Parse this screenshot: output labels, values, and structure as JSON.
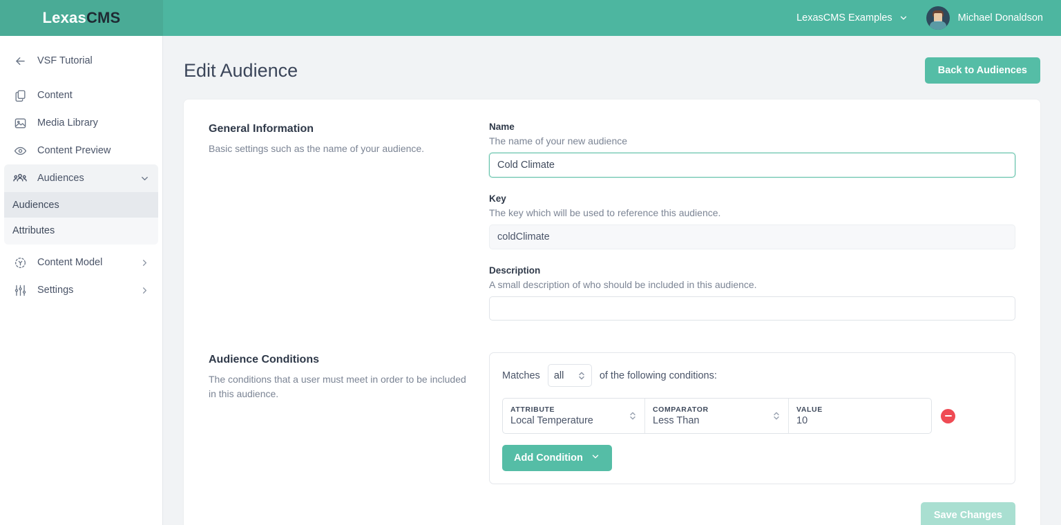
{
  "brand": {
    "logo_primary": "Lexas",
    "logo_secondary": "CMS",
    "accent": "#55bda6",
    "topbar_bg": "#4db6a0",
    "danger": "#ef4b54"
  },
  "topbar": {
    "org_switcher_label": "LexasCMS Examples",
    "org_switcher_icon": "chevron-down-icon",
    "avatar_icon": "user-avatar",
    "user_name": "Michael Donaldson"
  },
  "sidebar": {
    "back": {
      "label": "VSF Tutorial",
      "icon": "arrow-left-icon"
    },
    "items": [
      {
        "label": "Content",
        "icon": "documents-icon",
        "caret": ""
      },
      {
        "label": "Media Library",
        "icon": "image-icon",
        "caret": ""
      },
      {
        "label": "Content Preview",
        "icon": "eye-icon",
        "caret": ""
      },
      {
        "label": "Audiences",
        "icon": "users-icon",
        "caret": "chevron-down-icon"
      },
      {
        "label": "Content Model",
        "icon": "content-model-icon",
        "caret": "chevron-right-icon"
      },
      {
        "label": "Settings",
        "icon": "sliders-icon",
        "caret": "chevron-right-icon"
      }
    ],
    "sub_items": [
      {
        "label": "Audiences",
        "active": true
      },
      {
        "label": "Attributes",
        "active": false
      }
    ]
  },
  "page": {
    "title": "Edit Audience",
    "back_button": "Back to Audiences",
    "save_button": "Save Changes"
  },
  "general": {
    "section_title": "General Information",
    "section_desc": "Basic settings such as the name of your audience.",
    "name": {
      "label": "Name",
      "hint": "The name of your new audience",
      "value": "Cold Climate",
      "placeholder": ""
    },
    "key": {
      "label": "Key",
      "hint": "The key which will be used to reference this audience.",
      "value": "coldClimate",
      "placeholder": ""
    },
    "description": {
      "label": "Description",
      "hint": "A small description of who should be included in this audience.",
      "value": "",
      "placeholder": ""
    }
  },
  "conditions": {
    "section_title": "Audience Conditions",
    "section_desc": "The conditions that a user must meet in order to be included in this audience.",
    "matches_prefix": "Matches",
    "matches_value": "all",
    "matches_suffix": "of the following conditions:",
    "matches_icon": "up-down-chevron-icon",
    "rows": [
      {
        "attribute_header": "ATTRIBUTE",
        "attribute_value": "Local Temperature",
        "comparator_header": "COMPARATOR",
        "comparator_value": "Less Than",
        "value_header": "VALUE",
        "value_value": "10",
        "remove_icon": "minus-circle-icon"
      }
    ],
    "add_button": "Add Condition",
    "add_button_icon": "chevron-down-icon"
  }
}
